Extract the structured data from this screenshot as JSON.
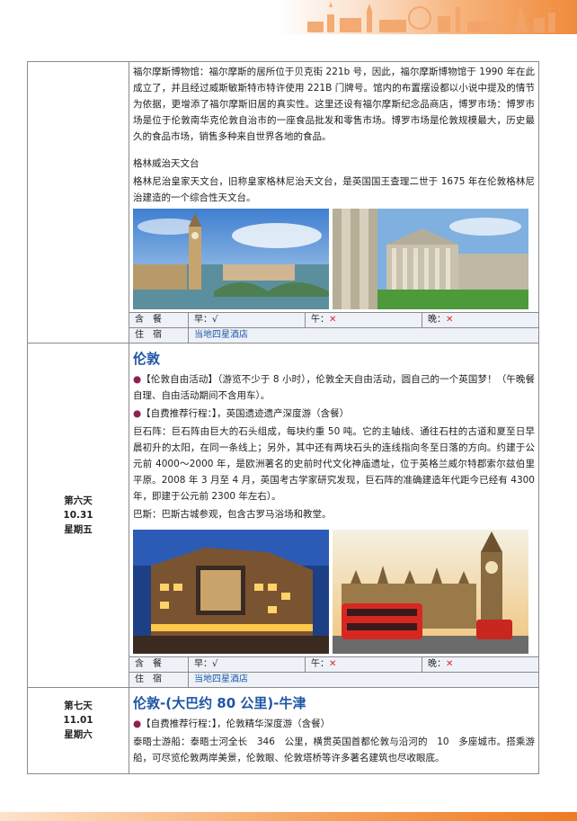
{
  "continued": {
    "lines": [
      "福尔摩斯博物馆：福尔摩斯的居所位于贝克街 221b 号，因此，福尔摩斯博物馆于 1990 年在此成立了，并且经过威斯敏斯特市特许使用 221B 门牌号。馆内的布置摆设都以小说中提及的情节为依据，更增添了福尔摩斯旧居的真实性。这里还设有福尔摩斯纪念品商店，博罗市场：博罗市场是位于伦敦南华克伦敦自治市的一座食品批发和零售市场。博罗市场是伦敦规模最大，历史最久的食品市场，销售多种来自世界各地的食品。"
    ],
    "sub_title": "格林威治天文台",
    "sub_text": "格林尼治皇家天文台，旧称皇家格林尼治天文台，是英国国王查理二世于 1675 年在伦敦格林尼治建造的一个综合性天文台。",
    "photo_left": "big-ben-bridge-photo",
    "photo_right": "british-museum-photo"
  },
  "meals_label": "含　餐",
  "stay_label": "住　宿",
  "day5_meals": {
    "breakfast": "早：√",
    "lunch_label": "午：",
    "lunch": "✕",
    "dinner_label": "晚：",
    "dinner": "✕"
  },
  "day5_stay": "当地四星酒店",
  "day6": {
    "day": "第六天",
    "date": "10.31",
    "weekday": "星期五",
    "title": "伦敦",
    "bullet": "●",
    "p1": "【伦敦自由活动】（游览不少于 8 小时），伦敦全天自由活动，圆自己的一个英国梦！（午晚餐自理、自由活动期间不含用车）。",
    "p2": "【自费推荐行程：】，英国遗迹遗产深度游（含餐）",
    "p3": "巨石阵：巨石阵由巨大的石头组成，每块约重 50 吨。它的主轴线、通往石柱的古道和夏至日早晨初升的太阳，在同一条线上；另外，其中还有两块石头的连线指向冬至日落的方向。约建于公元前 4000～2000 年，是欧洲著名的史前时代文化神庙遗址，位于英格兰威尔特郡索尔兹伯里平原。2008 年 3 月至 4 月，英国考古学家研究发现，巨石阵的准确建造年代距今已经有 4300 年，即建于公元前 2300 年左右）。",
    "p4": "巴斯：巴斯古城参观，包含古罗马浴场和教堂。",
    "meals": {
      "breakfast": "早：√",
      "lunch_label": "午：",
      "lunch": "✕",
      "dinner_label": "晚：",
      "dinner": "✕"
    },
    "stay": "当地四星酒店"
  },
  "day7": {
    "day": "第七天",
    "date": "11.01",
    "weekday": "星期六",
    "title": "伦敦-(大巴约 80 公里)-牛津",
    "bullet": "●",
    "p1": "【自费推荐行程：】，伦敦精华深度游（含餐）",
    "p2": "泰晤士游船：泰晤士河全长　346　公里，横贯英国首都伦敦与沿河的　10　多座城市。搭乘游船，可尽览伦敦两岸美景，伦敦眼、伦敦塔桥等许多著名建筑也尽收眼底。"
  },
  "colors": {
    "accent": "#1f56a6",
    "cross": "#e0242a",
    "bullet": "#8b2252",
    "band": "#f08a3c"
  }
}
